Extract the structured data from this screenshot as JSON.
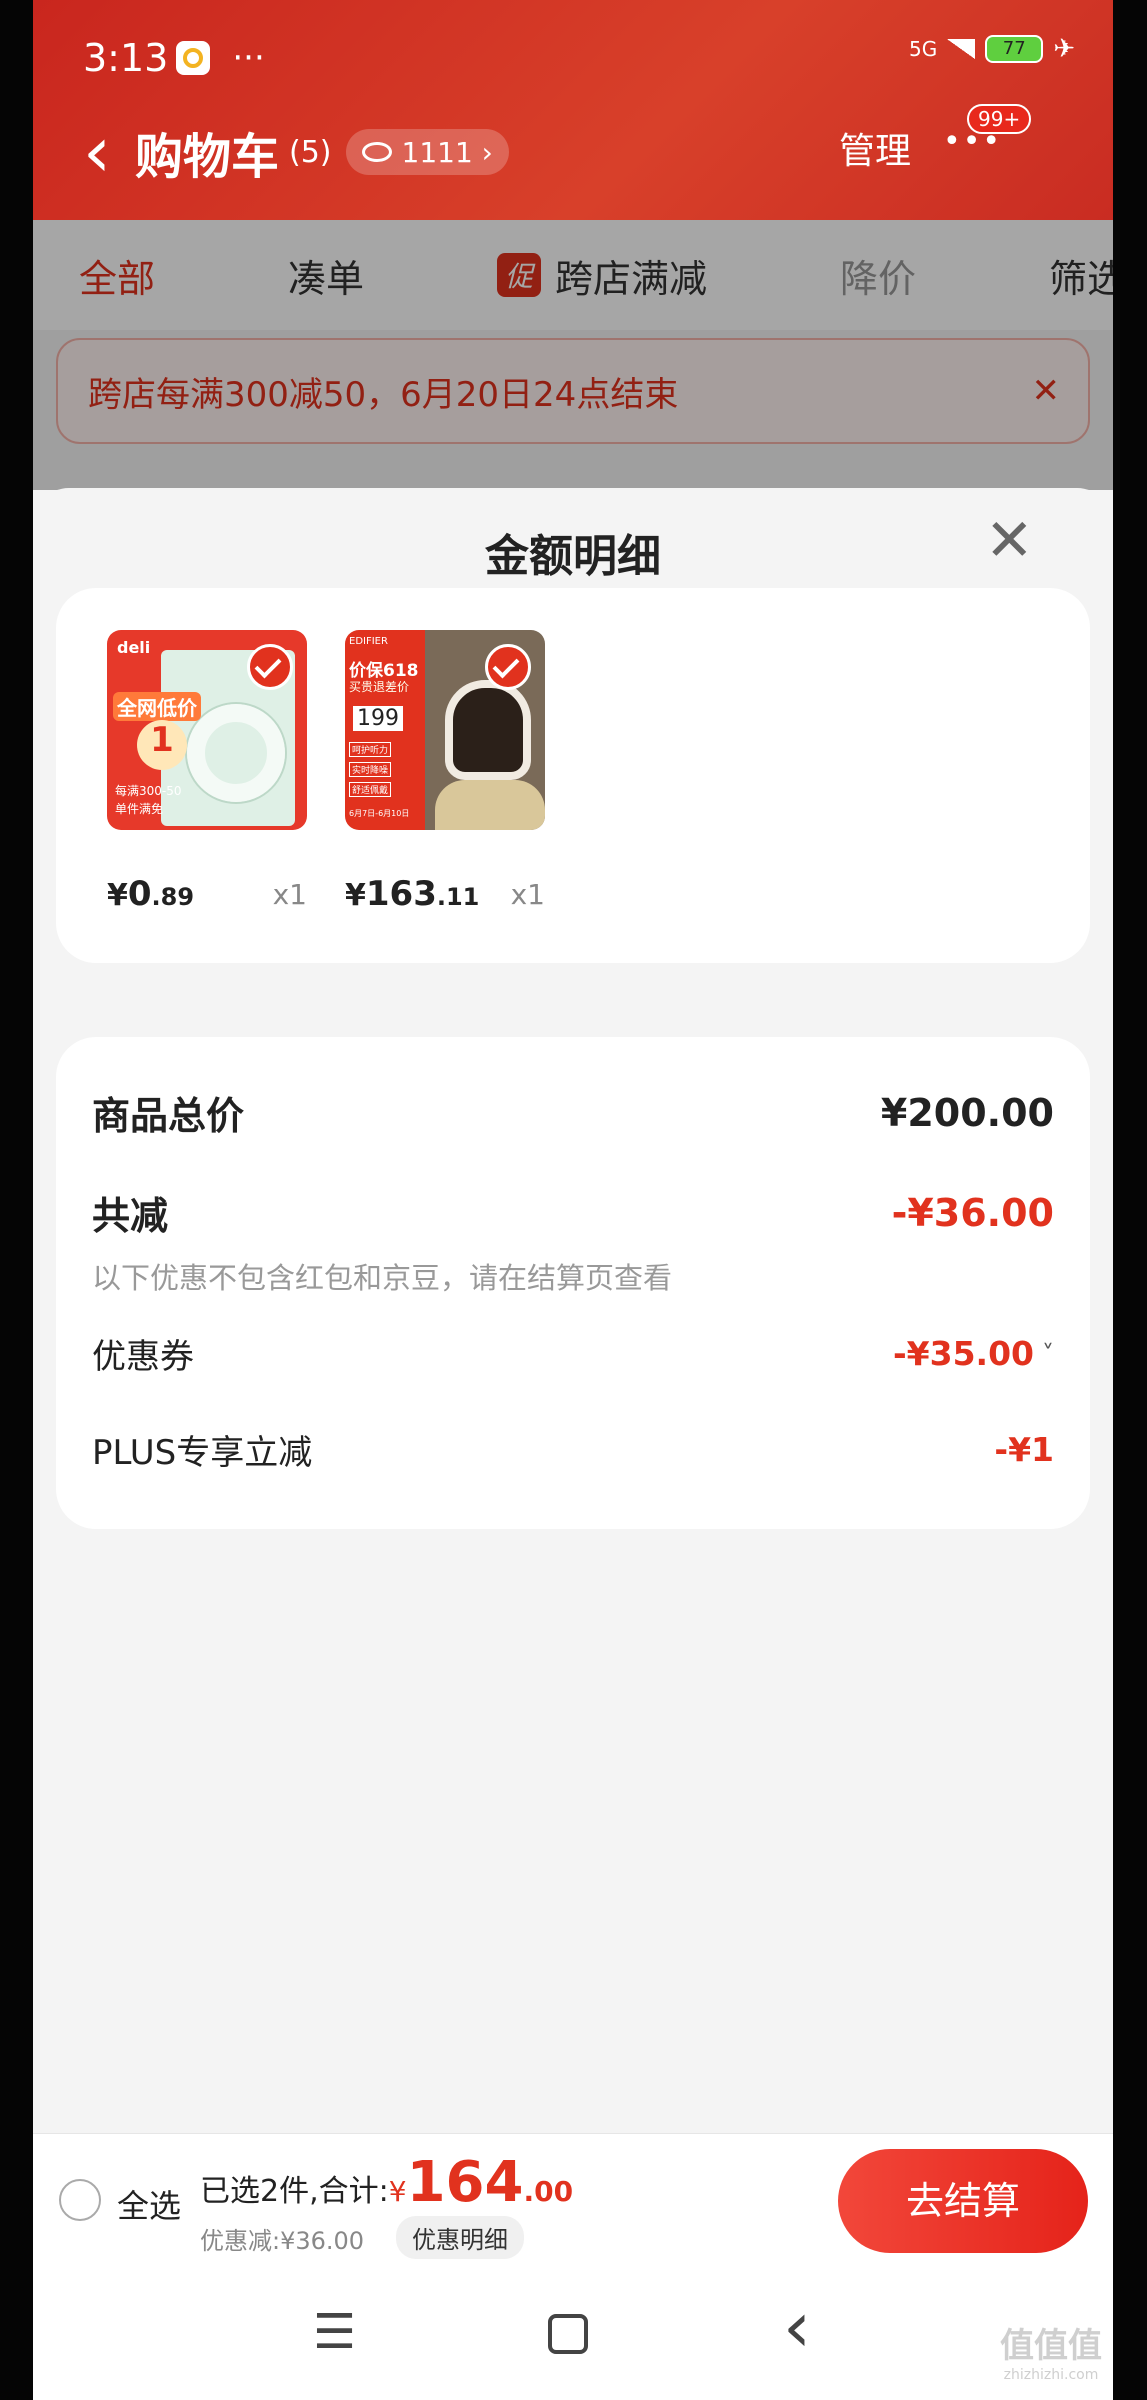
{
  "status": {
    "time": "3:13",
    "dots": "···",
    "net": "5G",
    "battery": "77"
  },
  "header": {
    "back": "‹",
    "title": "购物车",
    "count": "(5)",
    "follow": "1111 ›",
    "manage": "管理",
    "more": "•••",
    "badge": "99+"
  },
  "tabs": [
    {
      "label": "全部"
    },
    {
      "label": "凑单"
    },
    {
      "label": "跨店满减",
      "tag": "促"
    },
    {
      "label": "降价"
    },
    {
      "label": "筛选"
    }
  ],
  "banner": {
    "text": "跨店每满300减50，6月20日24点结束",
    "close": "✕"
  },
  "sheet": {
    "title": "金额明细",
    "close": "✕"
  },
  "products": [
    {
      "yen": "¥",
      "int": "0",
      "dec": ".89",
      "qty": "x1",
      "promo": "全网低价",
      "big": "1",
      "sub": "每满300-50",
      "sub2": "单件满免",
      "logo": "deli"
    },
    {
      "yen": "¥",
      "int": "163",
      "dec": ".11",
      "qty": "x1",
      "brand": "EDIFIER",
      "head": "价保618",
      "head2": "买贵退差价",
      "price": "199",
      "f1": "呵护听力",
      "f2": "实时降噪",
      "f3": "舒适佩戴",
      "date": "6月7日-6月10日"
    }
  ],
  "summary": {
    "total_label": "商品总价",
    "total_value": "¥200.00",
    "reduce_label": "共减",
    "reduce_value": "-¥36.00",
    "note": "以下优惠不包含红包和京豆，请在结算页查看",
    "coupon_label": "优惠券",
    "coupon_value": "-¥35.00",
    "chev": "˅",
    "plus_label": "PLUS专享立减",
    "plus_value": "-¥1"
  },
  "bottom": {
    "select_all": "全选",
    "selected": "已选2件,合计:",
    "yen": "¥",
    "int": "164",
    "dec": ".00",
    "discount": "优惠减:¥36.00",
    "detail": "优惠明细",
    "checkout": "去结算"
  },
  "navbar": {
    "menu": "☰",
    "back": "‹"
  },
  "watermark": {
    "text": "值值值",
    "sub": "zhizhizhi.com"
  },
  "colors": {
    "accent": "#e1321e",
    "header": "#d4352a"
  }
}
